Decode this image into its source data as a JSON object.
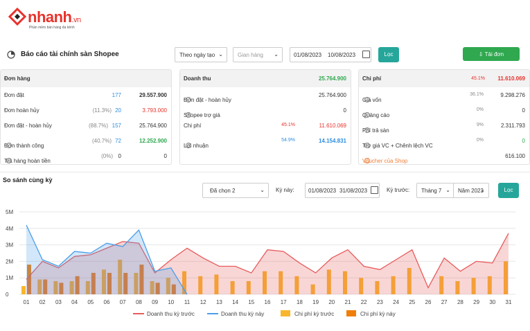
{
  "brand": {
    "name": "nhanh",
    "suffix": ".vn",
    "tagline": "Phần mềm bán hàng đa kênh"
  },
  "toolbar": {
    "title": "Báo cáo tài chính sàn Shopee",
    "period_select": "Theo ngày tạo",
    "booth_select": "Gian hàng",
    "date_from": "01/08/2023",
    "date_to": "10/08/2023",
    "filter_label": "Lọc",
    "download_label": "Tải đơn"
  },
  "orders_card": {
    "title": "Đơn hàng",
    "rows": [
      {
        "label": "Đơn đặt",
        "pct": "",
        "count": "177",
        "value": "29.557.900"
      },
      {
        "label": "Đơn hoàn hủy",
        "pct": "(11.3%)",
        "count": "20",
        "value": "3.793.000"
      },
      {
        "label": "Đơn đặt - hoàn hủy",
        "pct": "(88.7%)",
        "count": "157",
        "value": "25.764.900"
      },
      {
        "label": "Đơn thành công",
        "pct": "(40.7%)",
        "count": "72",
        "value": "12.252.900"
      },
      {
        "label": "Trả hàng hoàn tiền",
        "pct": "(0%)",
        "count": "0",
        "value": "0"
      }
    ]
  },
  "revenue_card": {
    "title": "Doanh thu",
    "total": "25.764.900",
    "rows": [
      {
        "label": "Đơn đặt - hoàn hủy",
        "pct": "",
        "value": "25.764.900"
      },
      {
        "label": "Shopee trợ giá",
        "pct": "",
        "value": "0"
      },
      {
        "label": "Chi phí",
        "pct": "45.1%",
        "value": "11.610.069"
      },
      {
        "label": "Lợi nhuận",
        "pct": "54.9%",
        "value": "14.154.831"
      }
    ]
  },
  "cost_card": {
    "title": "Chi phí",
    "pct": "45.1%",
    "total": "11.610.069",
    "rows": [
      {
        "label": "Giá vốn",
        "pct": "36.1%",
        "value": "9.298.276"
      },
      {
        "label": "Quảng cáo",
        "pct": "0%",
        "value": "0"
      },
      {
        "label": "Phí trả sàn",
        "pct": "9%",
        "value": "2.311.793"
      },
      {
        "label": "Trợ giá VC + Chênh lệch VC",
        "pct": "0%",
        "value": "0"
      },
      {
        "label": "Voucher của Shop",
        "pct": "",
        "value": "616.100"
      }
    ]
  },
  "compare": {
    "title": "So sánh cùng kỳ",
    "selected": "Đã chọn 2",
    "current_label": "Kỳ này:",
    "current_from": "01/08/2023",
    "current_to": "31/08/2023",
    "previous_label": "Kỳ trước:",
    "month": "Tháng 7",
    "year": "Năm 2023",
    "filter_label": "Lọc"
  },
  "colors": {
    "teal": "#26a69a",
    "green": "#2fa84f",
    "red": "#e8322b",
    "blue": "#2d8ce0",
    "orange_light": "#f8b62d",
    "orange_dark": "#f07f0a"
  },
  "chart_data": {
    "type": "line",
    "categories": [
      "01",
      "02",
      "03",
      "04",
      "05",
      "06",
      "07",
      "08",
      "09",
      "10",
      "11",
      "12",
      "13",
      "14",
      "15",
      "16",
      "17",
      "18",
      "19",
      "20",
      "21",
      "22",
      "23",
      "24",
      "25",
      "26",
      "27",
      "28",
      "29",
      "30",
      "31"
    ],
    "yticks": [
      "0",
      "1M",
      "2M",
      "3M",
      "4M",
      "5M"
    ],
    "ylim": [
      0,
      5000000
    ],
    "legend_position": "bottom",
    "series": [
      {
        "name": "Doanh thu kỳ trước",
        "kind": "area",
        "color": "#e85a5a",
        "values": [
          900000,
          2000000,
          1600000,
          2300000,
          2400000,
          2800000,
          3200000,
          3100000,
          1300000,
          2100000,
          2800000,
          2200000,
          1700000,
          1700000,
          1300000,
          2700000,
          2600000,
          1900000,
          1300000,
          2200000,
          2700000,
          1700000,
          1500000,
          2100000,
          2700000,
          400000,
          2200000,
          1400000,
          2000000,
          1900000,
          3700000
        ]
      },
      {
        "name": "Doanh thu kỳ này",
        "kind": "area",
        "color": "#4a9ee8",
        "values": [
          4200000,
          2100000,
          1700000,
          2600000,
          2500000,
          3100000,
          2900000,
          3900000,
          1400000,
          1600000,
          0,
          0,
          0,
          0,
          0,
          0,
          0,
          0,
          0,
          0,
          0,
          0,
          0,
          0,
          0,
          0,
          0,
          0,
          0,
          0,
          0
        ]
      },
      {
        "name": "Chi phí kỳ trước",
        "kind": "bar",
        "color": "#f8b62d",
        "values": [
          500000,
          900000,
          800000,
          800000,
          800000,
          1500000,
          2100000,
          1300000,
          800000,
          1000000,
          1400000,
          1100000,
          1200000,
          800000,
          800000,
          1400000,
          1400000,
          1100000,
          600000,
          1500000,
          1400000,
          1000000,
          800000,
          1100000,
          1600000,
          0,
          1100000,
          800000,
          1000000,
          1100000,
          2000000
        ]
      },
      {
        "name": "Chi phí kỳ này",
        "kind": "bar",
        "color": "#f07f0a",
        "values": [
          1800000,
          900000,
          700000,
          1100000,
          1300000,
          1300000,
          1300000,
          1800000,
          700000,
          600000,
          0,
          0,
          0,
          0,
          0,
          0,
          0,
          0,
          0,
          0,
          0,
          0,
          0,
          0,
          0,
          0,
          0,
          0,
          0,
          0,
          0
        ]
      }
    ]
  }
}
